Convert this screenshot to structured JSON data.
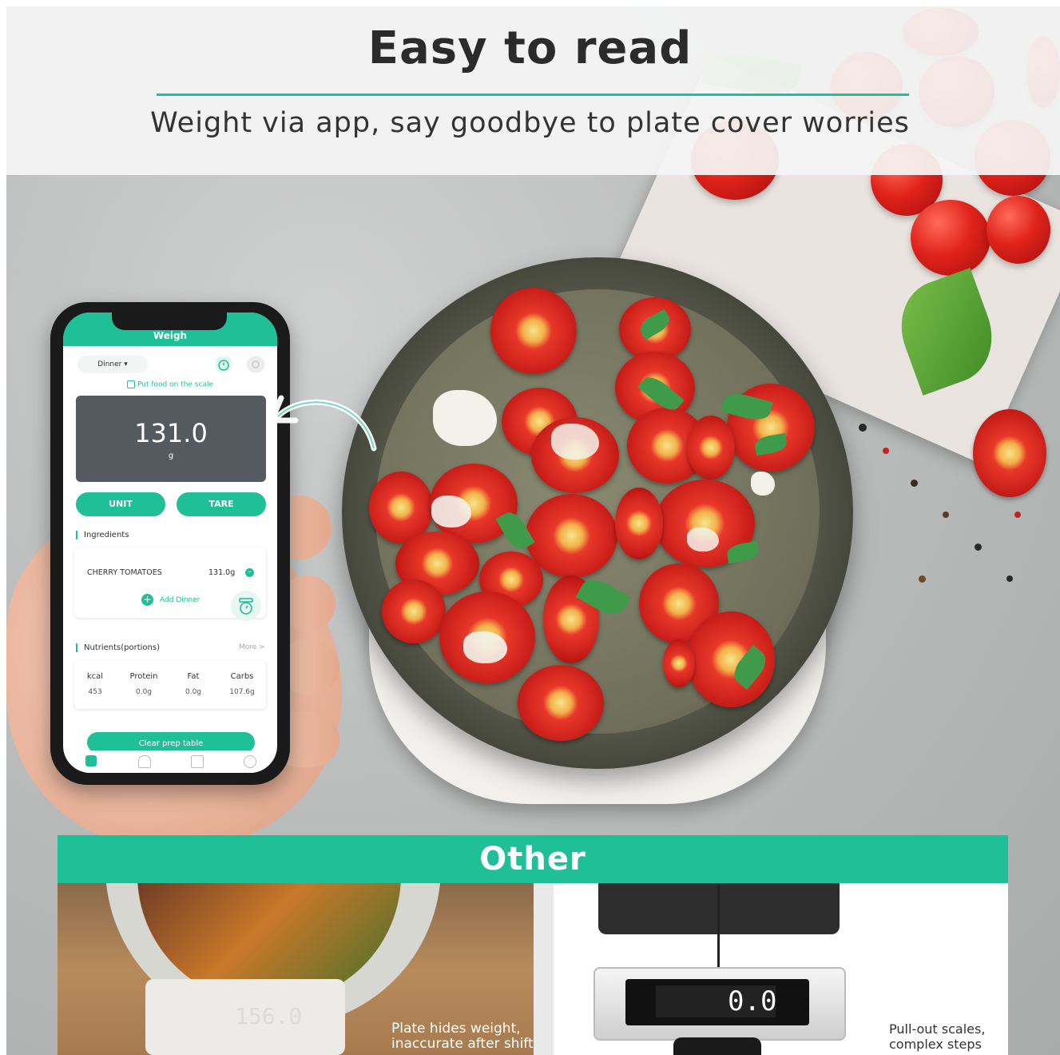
{
  "header": {
    "title": "Easy to read",
    "subtitle": "Weight via app, say goodbye to plate cover worries"
  },
  "app": {
    "screen_title": "Weigh",
    "meal_selector": "Dinner ▾",
    "hint": "Put food on the scale",
    "weight_value": "131.0",
    "weight_unit": "g",
    "unit_button": "UNIT",
    "tare_button": "TARE",
    "ingredients_label": "Ingredients",
    "ingredient": {
      "name": "CHERRY TOMATOES",
      "weight": "131.0g"
    },
    "add_button": "Add Dinner",
    "nutrients_label": "Nutrients(portions)",
    "more_link": "More >",
    "nutrients": [
      {
        "label": "kcal",
        "value": "453"
      },
      {
        "label": "Protein",
        "value": "0.0g"
      },
      {
        "label": "Fat",
        "value": "0.0g"
      },
      {
        "label": "Carbs",
        "value": "107.6g"
      }
    ],
    "clear_button": "Clear prep table",
    "tabs": [
      "home-tab-icon",
      "food-tab-icon",
      "stats-tab-icon",
      "profile-tab-icon"
    ]
  },
  "other": {
    "title": "Other",
    "left_caption_1": "Plate hides weight,",
    "left_caption_2": "inaccurate after shift",
    "left_display": "156.0",
    "right_caption_1": "Pull-out scales,",
    "right_caption_2": "complex steps",
    "right_display": "0.0"
  },
  "colors": {
    "accent": "#1fbf98",
    "display": "#555a60"
  }
}
